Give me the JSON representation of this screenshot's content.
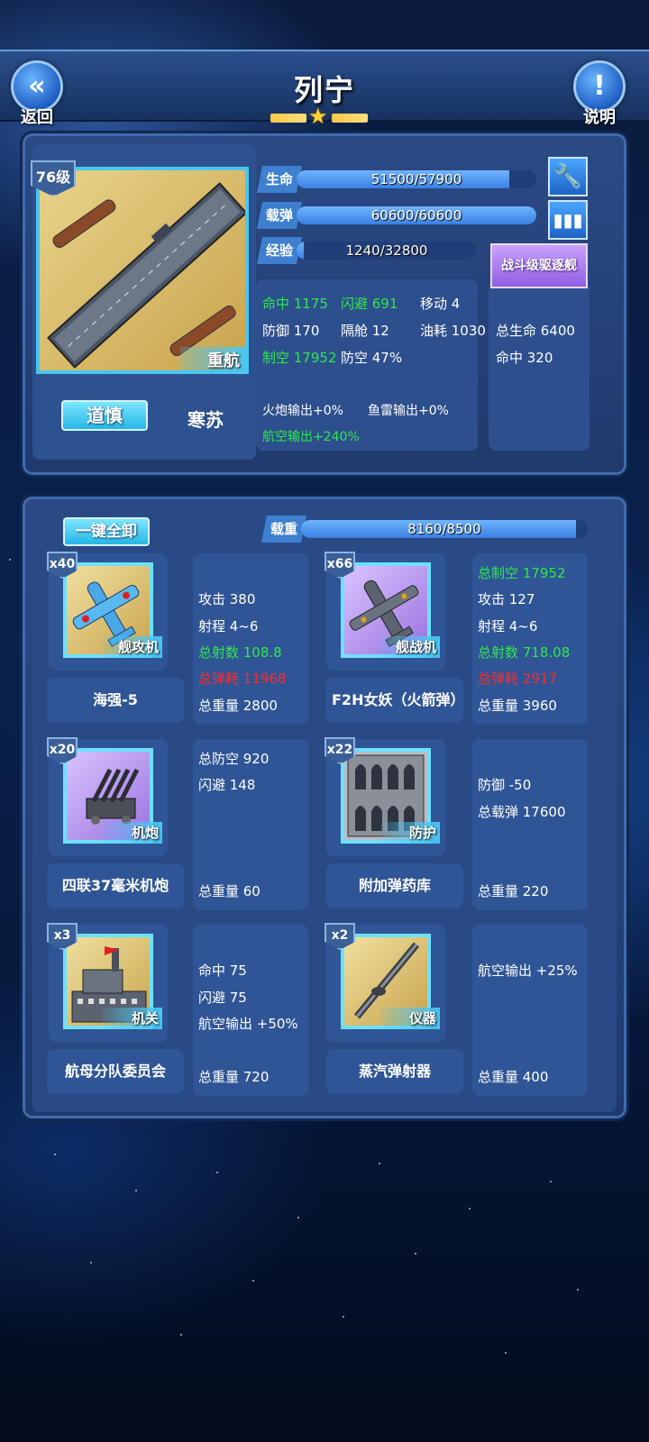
{
  "header": {
    "title": "列宁",
    "back_label": "返回",
    "help_label": "说明",
    "star_rank": 1
  },
  "ship": {
    "level": "76级",
    "type": "重航",
    "fleet_button": "道慎",
    "captain": "寒苏",
    "hp": {
      "label": "生命",
      "value": "51500/57900",
      "ratio": 0.889
    },
    "ammo": {
      "label": "载弹",
      "value": "60600/60600",
      "ratio": 1.0
    },
    "exp": {
      "label": "经验",
      "value": "1240/32800",
      "ratio": 0.038
    },
    "stats": {
      "accuracy": "命中 1175",
      "evasion": "闪避 691",
      "move": "移动 4",
      "defense": "防御 170",
      "compartment": "隔舱 12",
      "fuel": "油耗 1030",
      "air_control": "制空 17952",
      "aa": "防空 47%",
      "gun_output": "火炮输出+0%",
      "torpedo_output": "鱼雷输出+0%",
      "air_output": "航空输出+240%"
    },
    "class_bonus": {
      "button": "战斗级驱逐舰",
      "hp": "总生命 6400",
      "accuracy": "命中 320"
    }
  },
  "equipment": {
    "unequip_all": "一键全卸",
    "load": {
      "label": "载重",
      "value": "8160/8500",
      "ratio": 0.96
    },
    "slots": [
      {
        "count": "x40",
        "category": "舰攻机",
        "name": "海强-5",
        "stats": [
          "攻击 380",
          "射程 4~6",
          "总射数 108.8",
          "总弹耗 11968",
          "总重量 2800"
        ]
      },
      {
        "count": "x66",
        "category": "舰战机",
        "name": "F2H女妖（火箭弹）",
        "stats": [
          "总制空 17952",
          "攻击 127",
          "射程 4~6",
          "总射数 718.08",
          "总弹耗 2917",
          "总重量 3960"
        ]
      },
      {
        "count": "x20",
        "category": "机炮",
        "name": "四联37毫米机炮",
        "stats": [
          "总防空 920",
          "闪避 148",
          "总重量 60"
        ]
      },
      {
        "count": "x22",
        "category": "防护",
        "name": "附加弹药库",
        "stats": [
          "防御 -50",
          "总载弹 17600",
          "总重量 220"
        ]
      },
      {
        "count": "x3",
        "category": "机关",
        "name": "航母分队委员会",
        "stats": [
          "命中 75",
          "闪避 75",
          "航空输出 +50%",
          "总重量 720"
        ]
      },
      {
        "count": "x2",
        "category": "仪器",
        "name": "蒸汽弹射器",
        "stats": [
          "航空输出 +25%",
          "总重量 400"
        ]
      }
    ]
  },
  "colors": {
    "positive": "#2ee84a",
    "negative": "#ff2a2a",
    "accent": "#49c6f2"
  }
}
